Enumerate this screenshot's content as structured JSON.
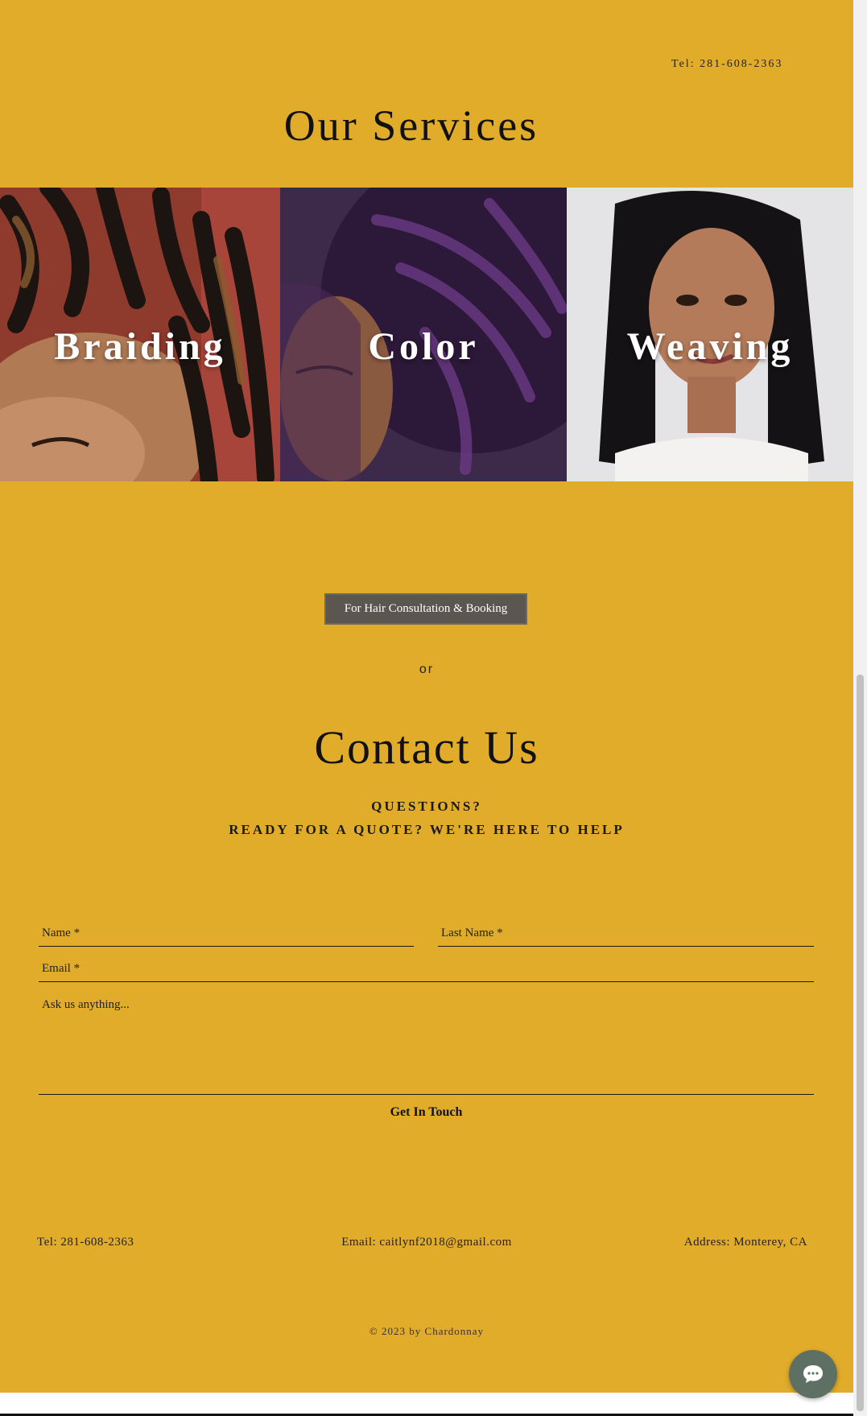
{
  "header": {
    "tel": "Tel: 281-608-2363"
  },
  "services": {
    "title": "Our Services",
    "tiles": [
      {
        "label": "Braiding"
      },
      {
        "label": "Color"
      },
      {
        "label": "Weaving"
      }
    ]
  },
  "booking": {
    "button_label": "For Hair Consultation & Booking",
    "or_text": "or"
  },
  "contact": {
    "title": "Contact Us",
    "subtitle_line1": "QUESTIONS?",
    "subtitle_line2": "READY FOR A QUOTE? WE'RE HERE TO HELP",
    "form": {
      "name_placeholder": "Name *",
      "last_name_placeholder": "Last Name *",
      "email_placeholder": "Email *",
      "message_placeholder": "Ask us anything...",
      "submit_label": "Get In Touch"
    }
  },
  "footer": {
    "tel": "Tel: 281-608-2363",
    "email": "Email: caitlynf2018@gmail.com",
    "address": "Address: Monterey, CA",
    "copyright": "© 2023 by Chardonnay"
  },
  "colors": {
    "background": "#e0ac2a",
    "button": "#5b5650",
    "chat": "#5e6f63"
  },
  "icons": {
    "chat": "chat-bubble-icon"
  }
}
